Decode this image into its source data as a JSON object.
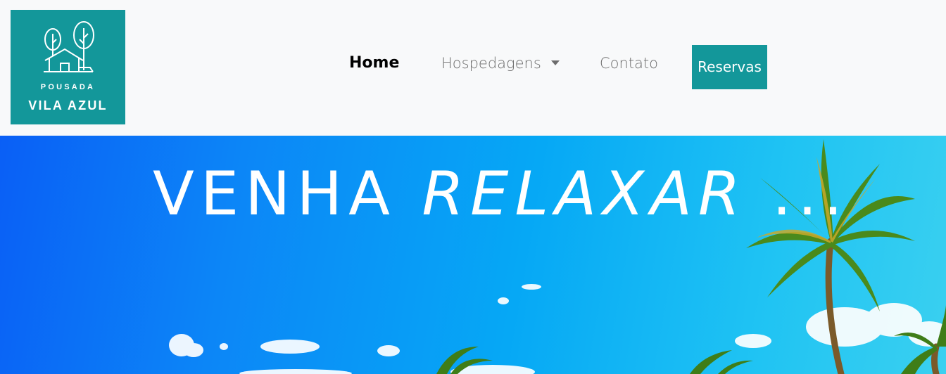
{
  "brand": {
    "line1": "POUSADA",
    "line2": "VILA AZUL",
    "color": "#13979a"
  },
  "nav": {
    "home": "Home",
    "hospedagens": "Hospedagens",
    "contato": "Contato",
    "reservas": "Reservas"
  },
  "hero": {
    "word1": "VENHA",
    "word2": "RELAXAR",
    "ellipsis": "..."
  },
  "icons": [
    "logo-house-trees-icon",
    "caret-down-icon"
  ]
}
